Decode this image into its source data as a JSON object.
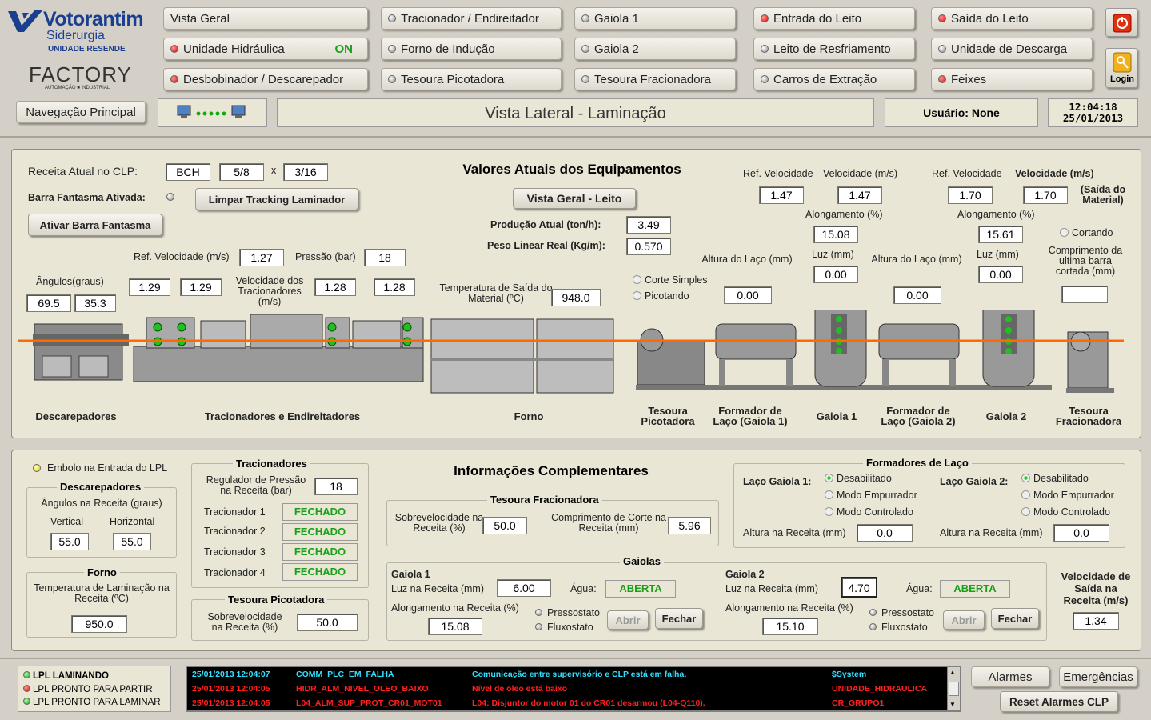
{
  "logo": {
    "brand": "Votorantim",
    "sub": "Siderurgia",
    "unit": "UNIDADE RESENDE",
    "factory": "FACTORY",
    "factory_sub": "AUTOMAÇÃO ■ INDUSTRIAL"
  },
  "nav": {
    "col1": [
      "Vista Geral",
      "Unidade Hidráulica",
      "Desbobinador / Descarepador"
    ],
    "hidr_status": "ON",
    "col2": [
      "Tracionador / Endireitador",
      "Forno de Indução",
      "Tesoura Picotadora"
    ],
    "col3": [
      "Gaiola 1",
      "Gaiola 2",
      "Tesoura Fracionadora"
    ],
    "col4": [
      "Entrada do Leito",
      "Leito de Resfriamento",
      "Carros de Extração"
    ],
    "col5": [
      "Saída do Leito",
      "Unidade de Descarga",
      "Feixes"
    ],
    "main_nav": "Navegação Principal",
    "login": "Login"
  },
  "screen_title": "Vista Lateral - Laminação",
  "user": "Usuário: None",
  "time": "12:04:18",
  "date": "25/01/2013",
  "top": {
    "receita_label": "Receita Atual no CLP:",
    "receita": [
      "BCH",
      "5/8",
      "x",
      "3/16"
    ],
    "barra_label": "Barra Fantasma Ativada:",
    "limpar_btn": "Limpar Tracking Laminador",
    "ativar_btn": "Ativar Barra Fantasma",
    "title": "Valores Atuais dos Equipamentos",
    "vista_btn": "Vista Geral - Leito",
    "prod_label": "Produção Atual (ton/h):",
    "prod": "3.49",
    "peso_label": "Peso Linear Real (Kg/m):",
    "peso": "0.570",
    "angulos_label": "Ângulos(graus)",
    "ang1": "69.5",
    "ang2": "35.3",
    "refvel_label": "Ref. Velocidade (m/s)",
    "refvel": "1.27",
    "pressao_label": "Pressão (bar)",
    "pressao": "18",
    "v1": "1.29",
    "v2": "1.29",
    "veltrac_label": "Velocidade dos Tracionadores (m/s)",
    "v3": "1.28",
    "v4": "1.28",
    "temp_label": "Temperatura de Saída do Material (ºC)",
    "temp": "948.0",
    "corte_simples": "Corte Simples",
    "picotando": "Picotando",
    "g1_refvel_label": "Ref. Velocidade",
    "g1_vel_label": "Velocidade (m/s)",
    "g1_refvel": "1.47",
    "g1_vel": "1.47",
    "g1_along_label": "Alongamento (%)",
    "g1_along": "15.08",
    "g1_luz_label": "Luz (mm)",
    "g1_luz": "0.00",
    "laco_label": "Altura do Laço (mm)",
    "laco1": "0.00",
    "laco2": "0.00",
    "g2_refvel_label": "Ref. Velocidade",
    "g2_vel_label": "Velocidade (m/s)",
    "g2_refvel": "1.70",
    "g2_vel": "1.70",
    "saida_label": "(Saída do Material)",
    "g2_along_label": "Alongamento (%)",
    "g2_along": "15.61",
    "g2_luz_label": "Luz (mm)",
    "g2_luz": "0.00",
    "cortando": "Cortando",
    "comp_label": "Comprimento da ultima barra cortada (mm)",
    "comp": "",
    "machines": [
      "Descarepadores",
      "Tracionadores e Endireitadores",
      "Forno",
      "Tesoura Picotadora",
      "Formador de Laço (Gaiola 1)",
      "Gaiola 1",
      "Formador de Laço (Gaiola 2)",
      "Gaiola 2",
      "Tesoura Fracionadora"
    ]
  },
  "info": {
    "title": "Informações Complementares",
    "embolo": "Embolo na Entrada do LPL",
    "desc_title": "Descarepadores",
    "desc_sub": "Ângulos na Receita (graus)",
    "vertical_label": "Vertical",
    "horizontal_label": "Horizontal",
    "vertical": "55.0",
    "horizontal": "55.0",
    "forno_title": "Forno",
    "forno_label": "Temperatura de Laminação na Receita (ºC)",
    "forno_temp": "950.0",
    "trac_title": "Tracionadores",
    "reg_label": "Regulador de Pressão na Receita (bar)",
    "reg": "18",
    "trac_items": [
      {
        "label": "Tracionador 1",
        "status": "FECHADO"
      },
      {
        "label": "Tracionador 2",
        "status": "FECHADO"
      },
      {
        "label": "Tracionador 3",
        "status": "FECHADO"
      },
      {
        "label": "Tracionador 4",
        "status": "FECHADO"
      }
    ],
    "picot_title": "Tesoura Picotadora",
    "picot_label": "Sobrevelocidade na Receita (%)",
    "picot": "50.0",
    "frac_title": "Tesoura Fracionadora",
    "frac_sv_label": "Sobrevelocidade na Receita (%)",
    "frac_sv": "50.0",
    "frac_comp_label": "Comprimento de Corte na Receita (mm)",
    "frac_comp": "5.96",
    "gaiolas_title": "Gaiolas",
    "g1_title": "Gaiola 1",
    "g1_luz_label": "Luz na Receita (mm)",
    "g1_luz": "6.00",
    "agua_label": "Água:",
    "g1_agua": "ABERTA",
    "g1_along_label": "Alongamento na Receita (%)",
    "g1_along": "15.08",
    "pressostato": "Pressostato",
    "fluxostato": "Fluxostato",
    "abrir": "Abrir",
    "fechar": "Fechar",
    "g2_title": "Gaiola 2",
    "g2_luz_label": "Luz na Receita (mm)",
    "g2_luz": "4.70",
    "g2_agua": "ABERTA",
    "g2_along_label": "Alongamento na Receita (%)",
    "g2_along": "15.10",
    "form_title": "Formadores de Laço",
    "laco1_label": "Laço Gaiola 1:",
    "laco2_label": "Laço Gaiola 2:",
    "modes": [
      "Desabilitado",
      "Modo Empurrador",
      "Modo Controlado"
    ],
    "altura_label": "Altura na Receita (mm)",
    "alt1": "0.0",
    "alt2": "0.0",
    "vel_saida_label": "Velocidade de Saída na Receita (m/s)",
    "vel_saida": "1.34"
  },
  "status": [
    "LPL LAMINANDO",
    "LPL PRONTO PARA PARTIR",
    "LPL PRONTO PARA LAMINAR"
  ],
  "alarms": [
    {
      "time": "25/01/2013 12:04:07",
      "tag": "COMM_PLC_EM_FALHA",
      "msg": "Comunicação entre supervisório e CLP está em falha.",
      "area": "$System",
      "color": "#30e0ff"
    },
    {
      "time": "25/01/2013 12:04:05",
      "tag": "HIDR_ALM_NIVEL_OLEO_BAIXO",
      "msg": "Nível de óleo está baixo",
      "area": "UNIDADE_HIDRAULICA",
      "color": "#ff2020"
    },
    {
      "time": "25/01/2013 12:04:05",
      "tag": "L04_ALM_SUP_PROT_CR01_MOT01",
      "msg": "L04: Disjuntor do motor 01 do CR01 desarmou (L04-Q110).",
      "area": "CR_GRUPO1",
      "color": "#ff2020"
    }
  ],
  "buttons": {
    "alarmes": "Alarmes",
    "emergencias": "Emergências",
    "reset": "Reset Alarmes CLP"
  }
}
